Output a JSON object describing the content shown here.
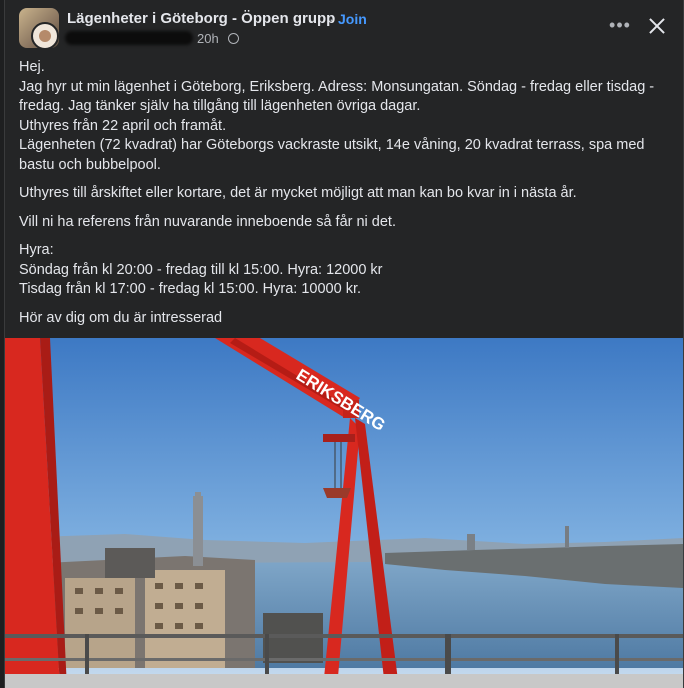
{
  "post": {
    "group_name": "Lägenheter i Göteborg - Öppen grupp",
    "separator": "·",
    "join_label": "Join",
    "time": "20h",
    "icons": {
      "more": "more-options-icon",
      "close": "close-icon",
      "privacy": "globe-icon"
    },
    "accent_color": "#4599ff",
    "paragraphs": [
      [
        "Hej.",
        "Jag hyr ut min lägenhet i Göteborg, Eriksberg. Adress: Monsungatan. Söndag - fredag eller tisdag -",
        "fredag. Jag tänker själv ha tillgång till lägenheten övriga dagar.",
        "Uthyres från 22 april och framåt.",
        "Lägenheten (72 kvadrat) har Göteborgs vackraste utsikt, 14e våning, 20 kvadrat terrass, spa med",
        "bastu och bubbelpool."
      ],
      [
        "Uthyres till årskiftet eller kortare, det är mycket möjligt att man kan bo kvar in i nästa år."
      ],
      [
        "Vill ni ha referens från nuvarande inneboende så får ni det."
      ],
      [
        "Hyra:",
        "Söndag från kl 20:00 - fredag till kl 15:00. Hyra: 12000 kr",
        "Tisdag från kl 17:00 - fredag kl 15:00. Hyra: 10000 kr."
      ],
      [
        "Hör av dig om du är intresserad"
      ]
    ],
    "photo_sign": "ERIKSBERG"
  }
}
